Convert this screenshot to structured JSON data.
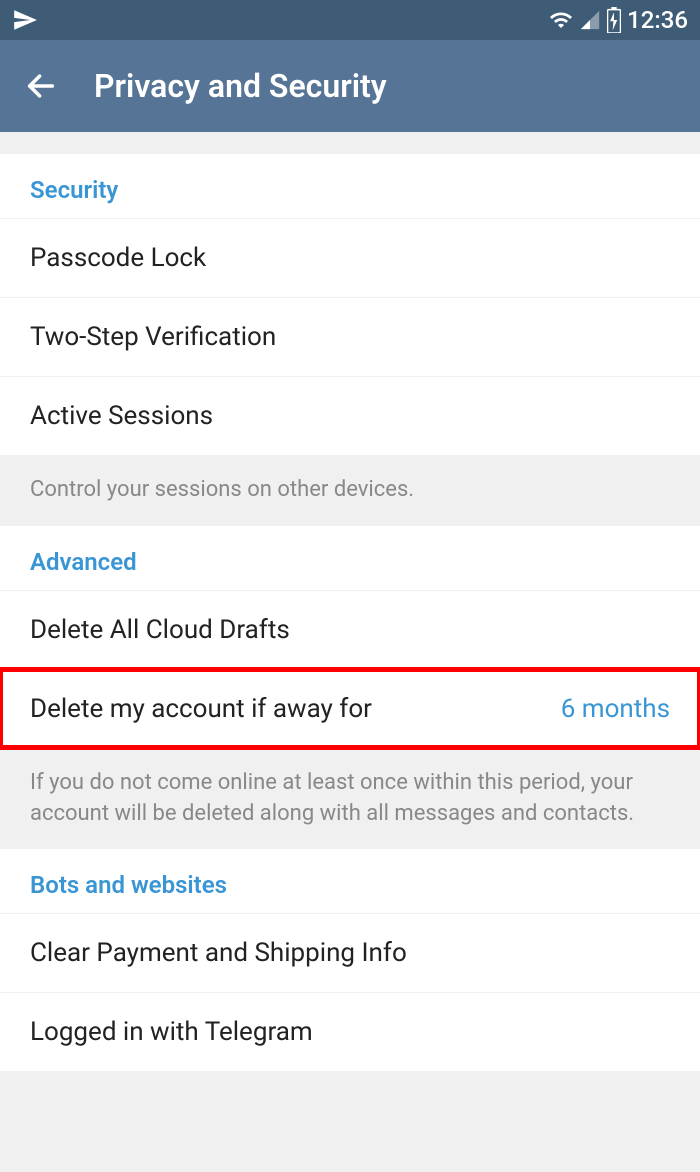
{
  "status": {
    "time": "12:36"
  },
  "header": {
    "title": "Privacy and Security"
  },
  "sections": {
    "security": {
      "title": "Security",
      "items": [
        "Passcode Lock",
        "Two-Step Verification",
        "Active Sessions"
      ],
      "footer": "Control your sessions on other devices."
    },
    "advanced": {
      "title": "Advanced",
      "items": {
        "deleteDrafts": "Delete All Cloud Drafts",
        "deleteAccount": {
          "label": "Delete my account if away for",
          "value": "6 months"
        }
      },
      "footer": "If you do not come online at least once within this period, your account will be deleted along with all messages and contacts."
    },
    "bots": {
      "title": "Bots and websites",
      "items": [
        "Clear Payment and Shipping Info",
        "Logged in with Telegram"
      ]
    }
  }
}
